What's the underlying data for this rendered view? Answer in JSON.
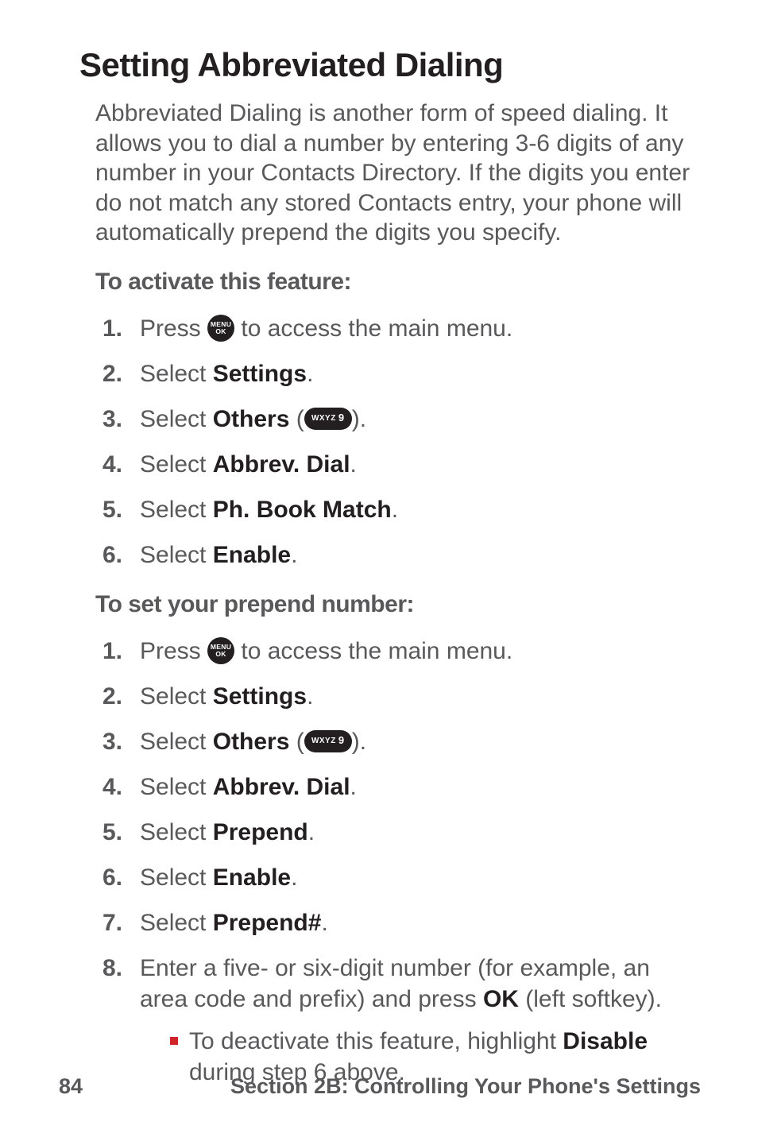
{
  "title": "Setting Abbreviated Dialing",
  "intro": "Abbreviated Dialing is another form of speed dialing. It allows you to dial a number by entering 3-6 digits of any number in your Contacts Directory. If the digits you enter do not match any stored Contacts entry, your phone will automatically prepend the digits you specify.",
  "activate": {
    "heading": "To activate this feature:",
    "steps": [
      {
        "num": "1.",
        "pre": "Press ",
        "key": "menu",
        "post": " to access the main menu."
      },
      {
        "num": "2.",
        "pre": "Select ",
        "bold": "Settings",
        "post": "."
      },
      {
        "num": "3.",
        "pre": "Select ",
        "bold": "Others",
        "post_open": " (",
        "key": "wxyz9",
        "post_close": ")."
      },
      {
        "num": "4.",
        "pre": "Select ",
        "bold": "Abbrev. Dial",
        "post": "."
      },
      {
        "num": "5.",
        "pre": "Select ",
        "bold": "Ph. Book Match",
        "post": "."
      },
      {
        "num": "6.",
        "pre": "Select ",
        "bold": "Enable",
        "post": "."
      }
    ]
  },
  "prepend": {
    "heading": "To set your prepend number:",
    "steps": [
      {
        "num": "1.",
        "pre": "Press ",
        "key": "menu",
        "post": " to access the main menu."
      },
      {
        "num": "2.",
        "pre": "Select ",
        "bold": "Settings",
        "post": "."
      },
      {
        "num": "3.",
        "pre": "Select ",
        "bold": "Others",
        "post_open": " (",
        "key": "wxyz9",
        "post_close": ")."
      },
      {
        "num": "4.",
        "pre": "Select ",
        "bold": "Abbrev. Dial",
        "post": "."
      },
      {
        "num": "5.",
        "pre": "Select ",
        "bold": "Prepend",
        "post": "."
      },
      {
        "num": "6.",
        "pre": "Select ",
        "bold": "Enable",
        "post": "."
      },
      {
        "num": "7.",
        "pre": "Select ",
        "bold": "Prepend#",
        "post": "."
      },
      {
        "num": "8.",
        "pre": "Enter a five- or six-digit number (for example, an area code and prefix) and press ",
        "bold": "OK",
        "post": " (left softkey).",
        "sub": {
          "pre": "To deactivate this feature, highlight ",
          "bold": "Disable",
          "post": " during step 6 above."
        }
      }
    ]
  },
  "key_labels": {
    "menu_l1": "MENU",
    "menu_l2": "OK",
    "wxyz9_letters": "WXYZ",
    "wxyz9_digit": "9"
  },
  "footer": {
    "page": "84",
    "section": "Section 2B: Controlling Your Phone's Settings"
  }
}
